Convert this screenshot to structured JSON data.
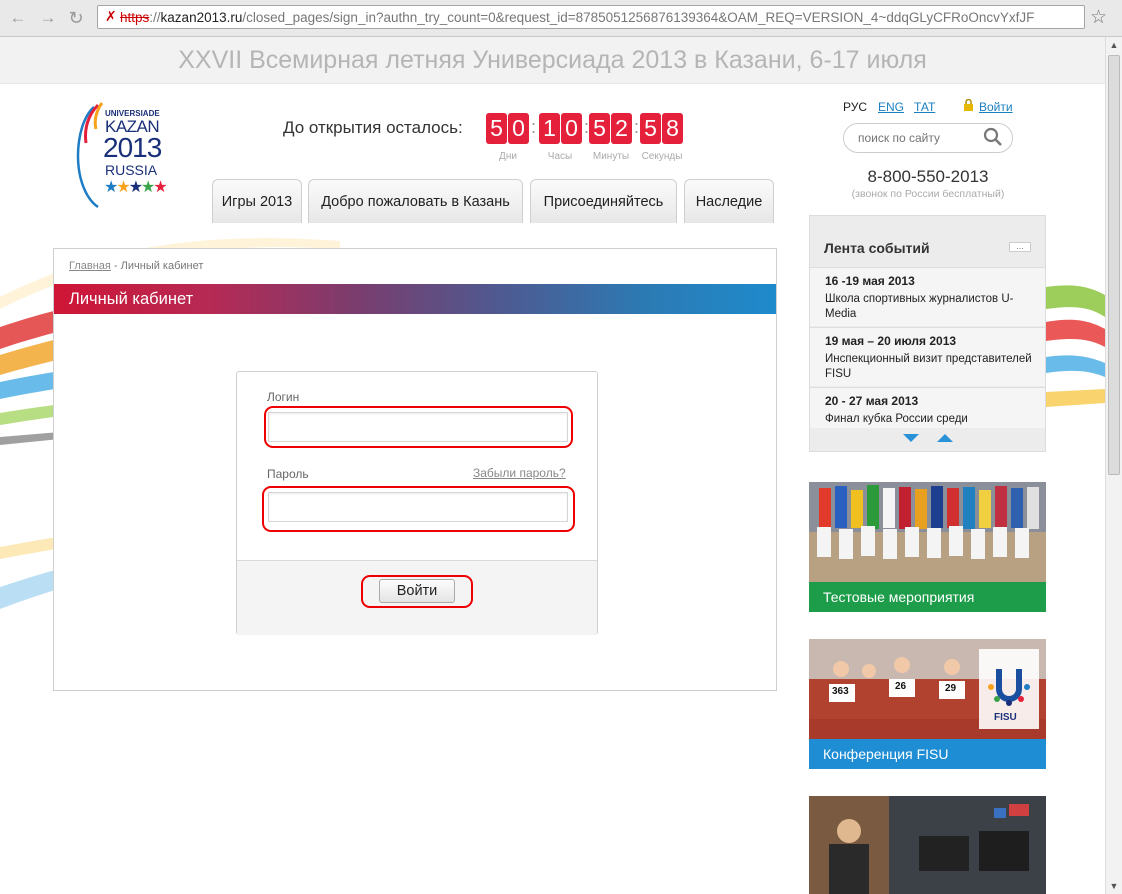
{
  "browser": {
    "url_protocol": "https",
    "url_host": "kazan2013.ru",
    "url_path": "/closed_pages/sign_in?authn_try_count=0&request_id=8785051256876139364&OAM_REQ=VERSION_4~ddqGLyCFRoOncvYxfJF"
  },
  "header": {
    "banner": "XXVII Всемирная летняя Универсиада 2013 в Казани, 6-17 июля",
    "logo": {
      "line1": "UNIVERSIADE",
      "line2": "KAZAN",
      "line3": "2013",
      "line4": "RUSSIA"
    },
    "countdown": {
      "label": "До открытия осталось:",
      "days": [
        "5",
        "0"
      ],
      "hours": [
        "1",
        "0"
      ],
      "minutes": [
        "5",
        "2"
      ],
      "seconds": [
        "5",
        "8"
      ],
      "units": [
        "Дни",
        "Часы",
        "Минуты",
        "Секунды"
      ]
    },
    "nav": [
      "Игры 2013",
      "Добро пожаловать в Казань",
      "Присоединяйтесь",
      "Наследие"
    ],
    "lang": {
      "ru": "РУС",
      "en": "ENG",
      "tt": "ТАТ"
    },
    "login": "Войти",
    "search_placeholder": "поиск по сайту",
    "phone": "8-800-550-2013",
    "phone_note": "(звонок по России бесплатный)"
  },
  "content": {
    "breadcrumb_home": "Главная",
    "breadcrumb_sep": " - ",
    "breadcrumb_current": "Личный кабинет",
    "title": "Личный кабинет",
    "form": {
      "login_label": "Логин",
      "password_label": "Пароль",
      "forgot": "Забыли пароль?",
      "submit": "Войти",
      "login_value": "",
      "password_value": ""
    }
  },
  "sidebar": {
    "feed_title": "Лента событий",
    "feed_more": "...",
    "events": [
      {
        "date": "16 -19 мая 2013",
        "text": "Школа спортивных журналистов U-Media"
      },
      {
        "date": "19 мая – 20 июля 2013",
        "text": "Инспекционный визит представителей FISU"
      },
      {
        "date": "20 - 27 мая 2013",
        "text": "Финал кубка России среди"
      }
    ],
    "promos": [
      {
        "caption": "Тестовые мероприятия"
      },
      {
        "caption": "Конференция FISU",
        "logo": "FISU",
        "bibs": [
          "363",
          "26",
          "29"
        ]
      }
    ]
  },
  "colors": {
    "accent_red": "#e4203a",
    "link_blue": "#1a7fc1",
    "ring_red": "#e00000"
  }
}
